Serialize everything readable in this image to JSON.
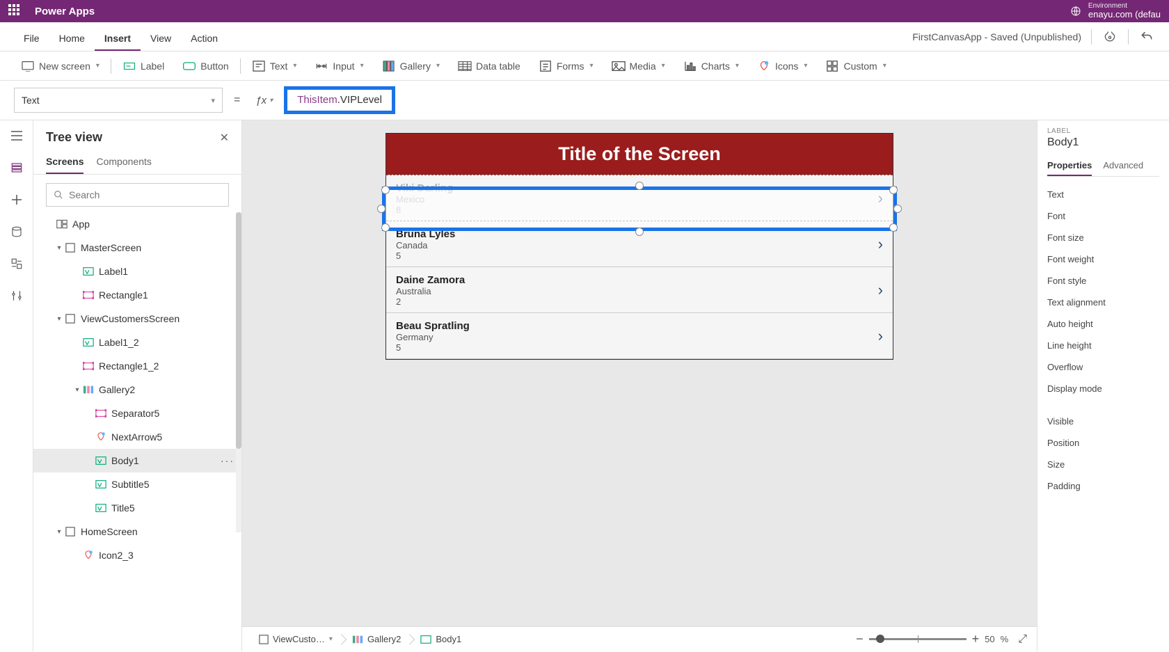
{
  "header": {
    "app_title": "Power Apps",
    "env_label": "Environment",
    "env_name": "enayu.com (defau"
  },
  "menubar": {
    "tabs": [
      "File",
      "Home",
      "Insert",
      "View",
      "Action"
    ],
    "active_index": 2,
    "status": "FirstCanvasApp - Saved (Unpublished)"
  },
  "ribbon": {
    "items": [
      {
        "label": "New screen",
        "icon": "screen",
        "caret": true
      },
      {
        "label": "Label",
        "icon": "label",
        "caret": false
      },
      {
        "label": "Button",
        "icon": "button",
        "caret": false
      },
      {
        "label": "Text",
        "icon": "text",
        "caret": true
      },
      {
        "label": "Input",
        "icon": "input",
        "caret": true
      },
      {
        "label": "Gallery",
        "icon": "gallery",
        "caret": true
      },
      {
        "label": "Data table",
        "icon": "datatable",
        "caret": false
      },
      {
        "label": "Forms",
        "icon": "forms",
        "caret": true
      },
      {
        "label": "Media",
        "icon": "media",
        "caret": true
      },
      {
        "label": "Charts",
        "icon": "charts",
        "caret": true
      },
      {
        "label": "Icons",
        "icon": "icons",
        "caret": true
      },
      {
        "label": "Custom",
        "icon": "custom",
        "caret": true
      }
    ]
  },
  "formula_bar": {
    "property": "Text",
    "expression_kw": "ThisItem",
    "expression_rest": ".VIPLevel"
  },
  "tree": {
    "title": "Tree view",
    "tabs": [
      "Screens",
      "Components"
    ],
    "active_tab": 0,
    "search_placeholder": "Search",
    "nodes": [
      {
        "label": "App",
        "indent": 0,
        "icon": "app",
        "chev": ""
      },
      {
        "label": "MasterScreen",
        "indent": 1,
        "icon": "screen",
        "chev": "▾"
      },
      {
        "label": "Label1",
        "indent": 2,
        "icon": "label",
        "chev": ""
      },
      {
        "label": "Rectangle1",
        "indent": 2,
        "icon": "rect",
        "chev": ""
      },
      {
        "label": "ViewCustomersScreen",
        "indent": 1,
        "icon": "screen",
        "chev": "▾"
      },
      {
        "label": "Label1_2",
        "indent": 2,
        "icon": "label",
        "chev": ""
      },
      {
        "label": "Rectangle1_2",
        "indent": 2,
        "icon": "rect",
        "chev": ""
      },
      {
        "label": "Gallery2",
        "indent": 2,
        "icon": "gallery",
        "chev": "▾"
      },
      {
        "label": "Separator5",
        "indent": 3,
        "icon": "rect",
        "chev": ""
      },
      {
        "label": "NextArrow5",
        "indent": 3,
        "icon": "iconctrl",
        "chev": ""
      },
      {
        "label": "Body1",
        "indent": 3,
        "icon": "label",
        "chev": "",
        "selected": true,
        "more": true
      },
      {
        "label": "Subtitle5",
        "indent": 3,
        "icon": "label",
        "chev": ""
      },
      {
        "label": "Title5",
        "indent": 3,
        "icon": "label",
        "chev": ""
      },
      {
        "label": "HomeScreen",
        "indent": 1,
        "icon": "screen",
        "chev": "▾"
      },
      {
        "label": "Icon2_3",
        "indent": 2,
        "icon": "iconctrl",
        "chev": ""
      }
    ]
  },
  "canvas": {
    "screen_title": "Title of the Screen",
    "items": [
      {
        "name": "Viki  Darling",
        "sub": "Mexico",
        "vip": "8"
      },
      {
        "name": "Bruna  Lyles",
        "sub": "Canada",
        "vip": "5"
      },
      {
        "name": "Daine  Zamora",
        "sub": "Australia",
        "vip": "2"
      },
      {
        "name": "Beau  Spratling",
        "sub": "Germany",
        "vip": "5"
      }
    ]
  },
  "breadcrumb": {
    "items": [
      "ViewCusto…",
      "Gallery2",
      "Body1"
    ]
  },
  "zoom": {
    "value": "50",
    "suffix": "%"
  },
  "properties": {
    "type_label": "LABEL",
    "name": "Body1",
    "tabs": [
      "Properties",
      "Advanced"
    ],
    "active_tab": 0,
    "rows": [
      "Text",
      "Font",
      "Font size",
      "Font weight",
      "Font style",
      "Text alignment",
      "Auto height",
      "Line height",
      "Overflow",
      "Display mode"
    ],
    "rows2": [
      "Visible",
      "Position",
      "Size",
      "Padding"
    ]
  }
}
